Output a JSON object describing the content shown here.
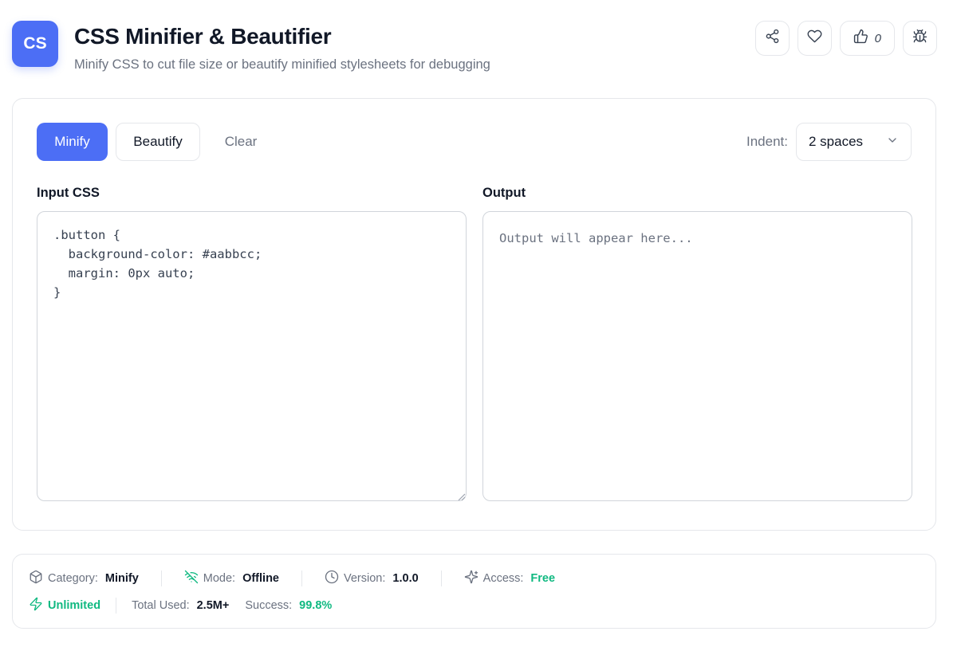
{
  "header": {
    "logo_text": "CS",
    "title": "CSS Minifier & Beautifier",
    "subtitle": "Minify CSS to cut file size or beautify minified stylesheets for debugging",
    "actions": {
      "share_icon": "share-icon",
      "favorite_icon": "heart-icon",
      "like_icon": "thumbs-up-icon",
      "like_count": "0",
      "report_icon": "bug-icon"
    }
  },
  "toolbar": {
    "minify_label": "Minify",
    "beautify_label": "Beautify",
    "clear_label": "Clear",
    "indent_label": "Indent:",
    "indent_value": "2 spaces"
  },
  "input": {
    "label": "Input CSS",
    "value": ".button {\n  background-color: #aabbcc;\n  margin: 0px auto;\n}"
  },
  "output": {
    "label": "Output",
    "placeholder": "Output will appear here..."
  },
  "stats": {
    "category_label": "Category:",
    "category_value": "Minify",
    "mode_label": "Mode:",
    "mode_value": "Offline",
    "version_label": "Version:",
    "version_value": "1.0.0",
    "access_label": "Access:",
    "access_value": "Free",
    "unlimited_label": "Unlimited",
    "total_used_label": "Total Used:",
    "total_used_value": "2.5M+",
    "success_label": "Success:",
    "success_value": "99.8%"
  },
  "colors": {
    "accent": "#4c6ef5",
    "green": "#10b981",
    "muted_text": "#6b7280",
    "border": "#e5e7eb"
  }
}
